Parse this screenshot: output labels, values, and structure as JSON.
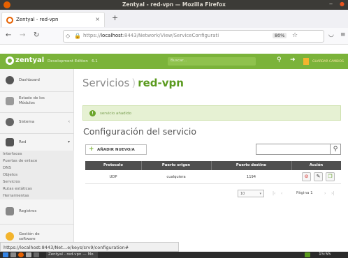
{
  "window": {
    "title": "Zentyal - red-vpn — Mozilla Firefox"
  },
  "browser": {
    "tab_title": "Zentyal - red-vpn",
    "url_prefix": "https://",
    "url_host": "localhost",
    "url_rest": ":8443/Network/View/ServiceConfigurati",
    "zoom": "80%",
    "status_url": "https://localhost:8443/Net…e/keys/srv9/configuration#"
  },
  "app": {
    "brand": "zentyal",
    "edition": "Development Edition",
    "edition_version": "6.1",
    "search_placeholder": "Buscar...",
    "save_changes": "GUARDAR CAMBIOS",
    "accent_color": "#7bb33a"
  },
  "sidebar": {
    "dashboard": "Dashboard",
    "module_status_l1": "Estado de los",
    "module_status_l2": "Módulos",
    "system": "Sistema",
    "network": "Red",
    "network_items": [
      "Interfaces",
      "Puertas de enlace",
      "DNS",
      "Objetos",
      "Servicios",
      "Rutas estáticas",
      "Herramientas"
    ],
    "logs": "Registros",
    "software_l1": "Gestión de",
    "software_l2": "software"
  },
  "main": {
    "breadcrumb_parent": "Servicios",
    "breadcrumb_separator": ")",
    "breadcrumb_current": "red-vpn",
    "success_message": "servicio añadido",
    "section_title": "Configuración del servicio",
    "add_button": "AÑADIR NUEVO/A",
    "table": {
      "headers": [
        "Protocolo",
        "Puerto origen",
        "Puerto destino",
        "Acción"
      ],
      "rows": [
        {
          "protocol": "UDP",
          "source_port": "cualquiera",
          "dest_port": "1194"
        }
      ]
    },
    "pagination": {
      "page_size": "10",
      "page_label": "Página 1"
    }
  },
  "taskbar": {
    "task_label": "Zentyal - red-vpn — Mo",
    "clock": "15:55"
  }
}
